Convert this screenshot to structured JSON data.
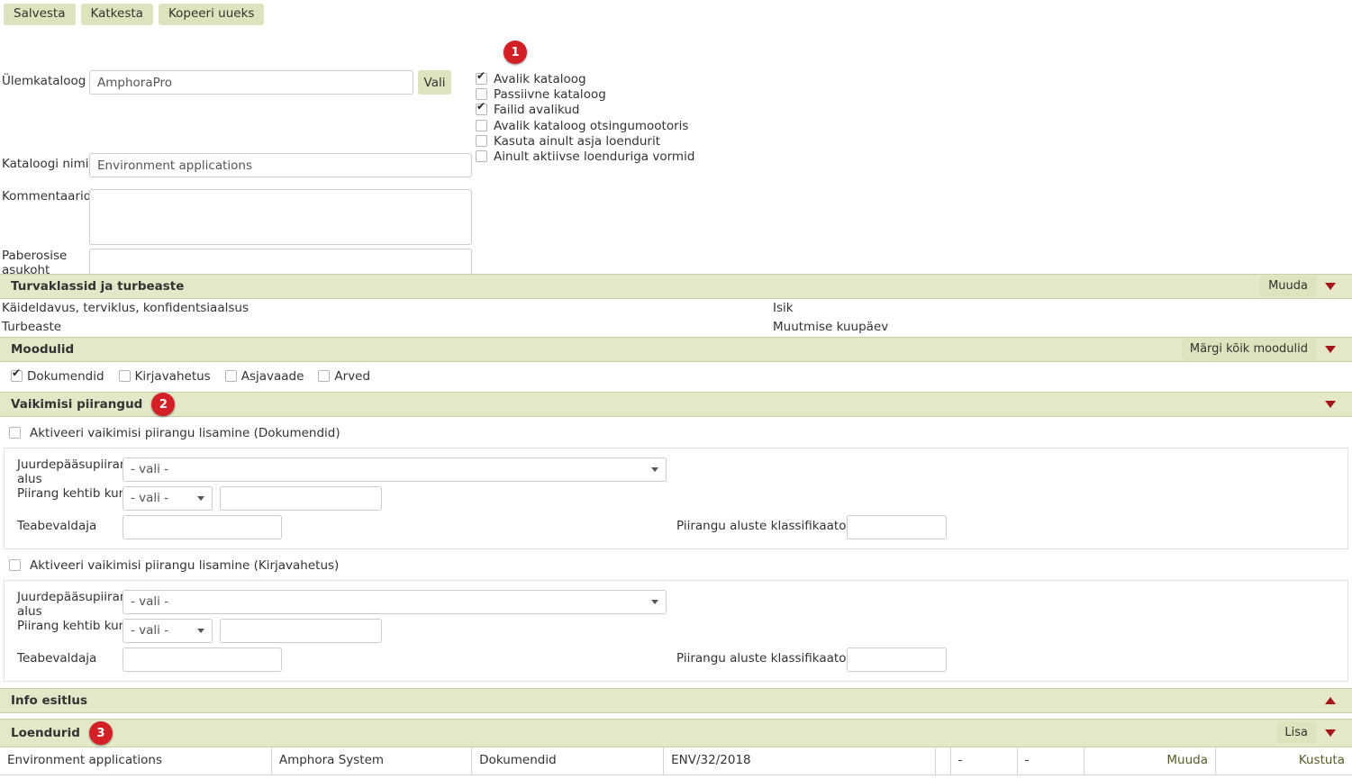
{
  "toolbar": {
    "save_label": "Salvesta",
    "cancel_label": "Katkesta",
    "copy_label": "Kopeeri uueks"
  },
  "form": {
    "parent_catalog_label": "Ülemkataloog",
    "parent_catalog_value": "AmphoraPro",
    "select_button_label": "Vali",
    "catalog_name_label": "Kataloogi nimi",
    "catalog_name_value": "Environment applications",
    "comments_label": "Kommentaarid",
    "comments_value": "",
    "paper_location_label": "Paberosise asukoht",
    "paper_location_value": ""
  },
  "options": [
    {
      "label": "Avalik kataloog",
      "checked": true
    },
    {
      "label": "Passiivne kataloog",
      "checked": false
    },
    {
      "label": "Failid avalikud",
      "checked": true
    },
    {
      "label": "Avalik kataloog otsingumootoris",
      "checked": false
    },
    {
      "label": "Kasuta ainult asja loendurit",
      "checked": false
    },
    {
      "label": "Ainult aktiivse loenduriga vormid",
      "checked": false
    }
  ],
  "badges": {
    "one": "1",
    "two": "2",
    "three": "3"
  },
  "security": {
    "title": "Turvaklassid ja turbeaste",
    "edit_button": "Muuda",
    "rows": [
      {
        "left": "Käideldavus, terviklus, konfidentsiaalsus",
        "right": "Isik"
      },
      {
        "left": "Turbeaste",
        "right": "Muutmise kuupäev"
      }
    ]
  },
  "modules": {
    "title": "Moodulid",
    "mark_all_button": "Märgi kõik moodulid",
    "items": [
      {
        "label": "Dokumendid",
        "checked": true
      },
      {
        "label": "Kirjavahetus",
        "checked": false
      },
      {
        "label": "Asjavaade",
        "checked": false
      },
      {
        "label": "Arved",
        "checked": false
      }
    ]
  },
  "restrictions": {
    "title": "Vaikimisi piirangud",
    "blocks": [
      {
        "activate_label": "Aktiveeri vaikimisi piirangu lisamine (Dokumendid)",
        "activate_checked": false,
        "basis_label": "Juurdepääsupiirangu alus",
        "basis_value": "- vali -",
        "valid_until_label": "Piirang kehtib kuni",
        "valid_until_value": "- vali -",
        "valid_until_text": "",
        "holder_label": "Teabevaldaja",
        "holder_value": "",
        "classifier_label": "Piirangu aluste klassifikaator",
        "classifier_value": ""
      },
      {
        "activate_label": "Aktiveeri vaikimisi piirangu lisamine (Kirjavahetus)",
        "activate_checked": false,
        "basis_label": "Juurdepääsupiirangu alus",
        "basis_value": "- vali -",
        "valid_until_label": "Piirang kehtib kuni",
        "valid_until_value": "- vali -",
        "valid_until_text": "",
        "holder_label": "Teabevaldaja",
        "holder_value": "",
        "classifier_label": "Piirangu aluste klassifikaator",
        "classifier_value": ""
      }
    ]
  },
  "info_presentation": {
    "title": "Info esitlus"
  },
  "counters": {
    "title": "Loendurid",
    "add_button": "Lisa",
    "rows": [
      {
        "c0": "Environment applications",
        "c1": "Amphora System",
        "c2": "Dokumendid",
        "c3": "ENV/32/2018",
        "c4": "",
        "c5": "-",
        "c6": "-",
        "c7": "Muuda",
        "c8": "Kustuta"
      }
    ]
  }
}
